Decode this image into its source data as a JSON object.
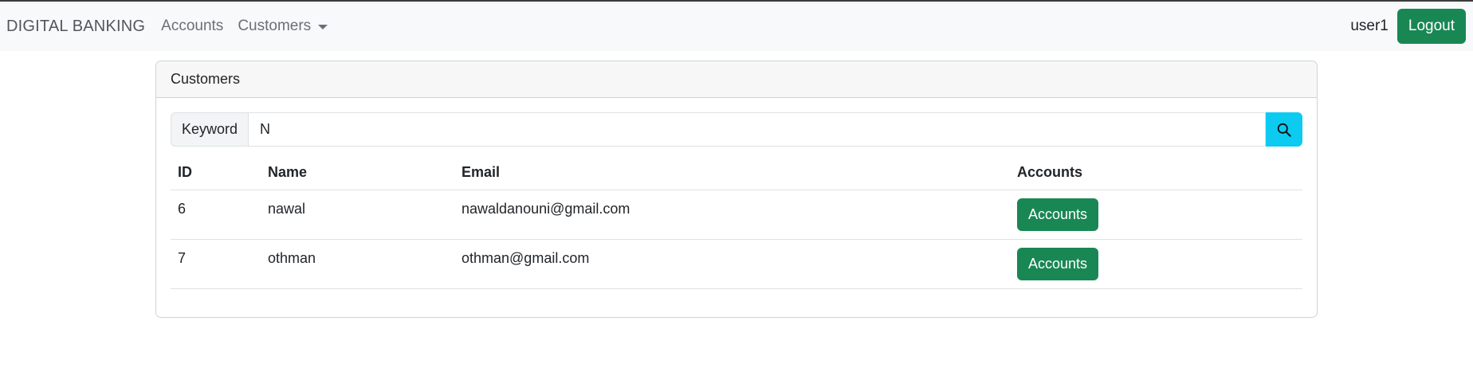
{
  "navbar": {
    "brand": "DIGITAL BANKING",
    "links": [
      {
        "label": "Accounts"
      },
      {
        "label": "Customers"
      }
    ],
    "username": "user1",
    "logout_label": "Logout"
  },
  "card": {
    "title": "Customers",
    "search": {
      "label": "Keyword",
      "value": "N",
      "button_icon": "search-icon"
    },
    "table": {
      "columns": [
        "ID",
        "Name",
        "Email",
        "Accounts"
      ],
      "rows": [
        {
          "id": "6",
          "name": "nawal",
          "email": "nawaldanouni@gmail.com",
          "action": "Accounts"
        },
        {
          "id": "7",
          "name": "othman",
          "email": "othman@gmail.com",
          "action": "Accounts"
        }
      ]
    }
  },
  "colors": {
    "navbar_bg": "#f8f9fa",
    "primary_green": "#198754",
    "search_button": "#0dcaf0"
  }
}
